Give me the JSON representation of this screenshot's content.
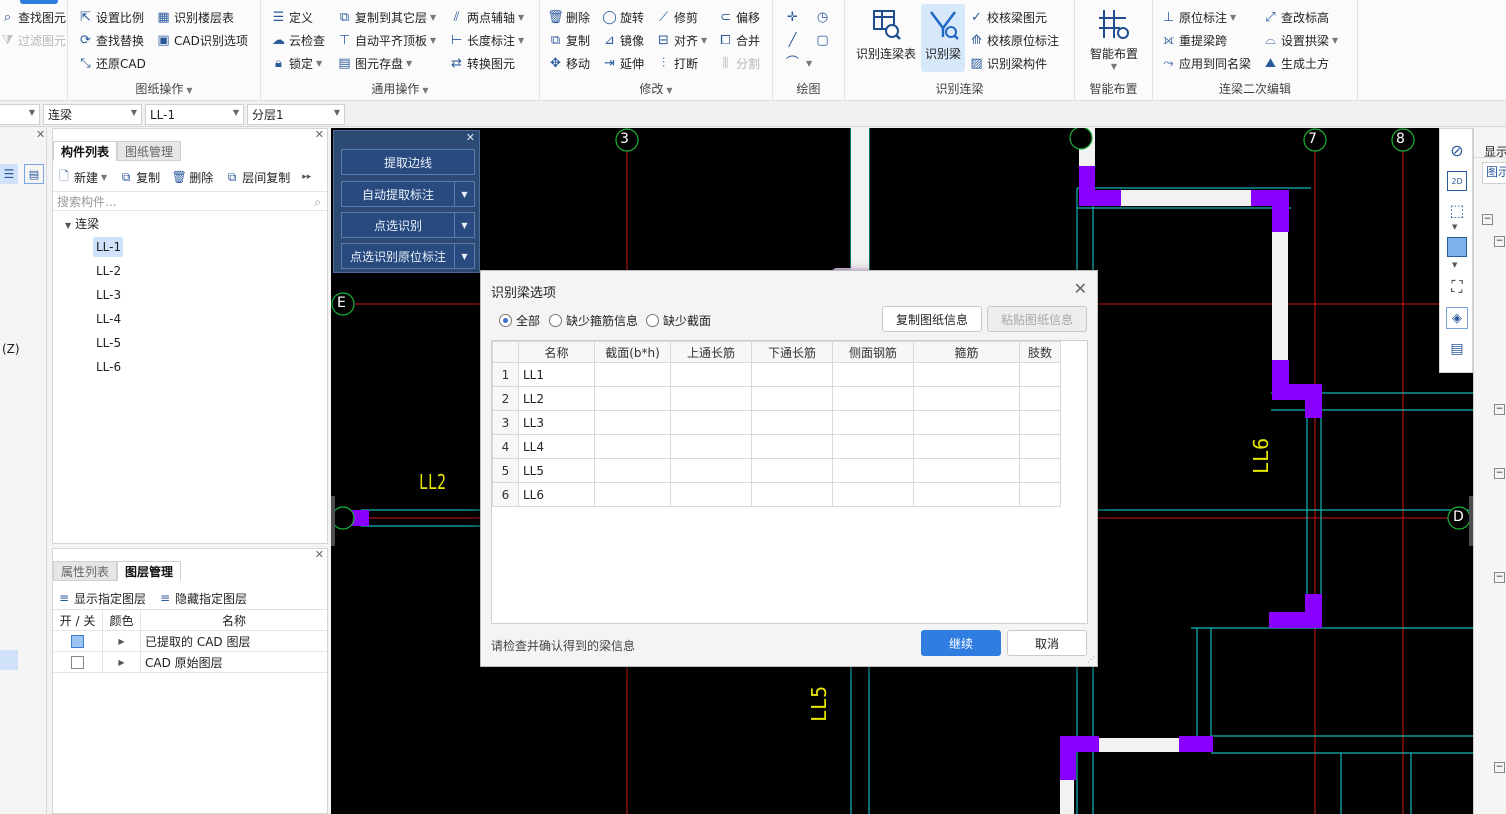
{
  "ribbon": {
    "grp_cad_tools": {
      "find_element": "查找图元",
      "filter_element": "过滤图元"
    },
    "grp_drawing_ops": {
      "title": "图纸操作",
      "set_scale": "设置比例",
      "find_replace": "查找替换",
      "restore_cad": "还原CAD",
      "identify_floor_table": "识别楼层表",
      "cad_identify_options": "CAD识别选项"
    },
    "grp_general_ops": {
      "title": "通用操作",
      "define": "定义",
      "cloud_check": "云检查",
      "lock": "锁定",
      "copy_to_other_floor": "复制到其它层",
      "auto_align_slab": "自动平齐顶板",
      "element_save": "图元存盘",
      "two_point_axis": "两点辅轴",
      "length_dim": "长度标注",
      "convert_element": "转换图元"
    },
    "grp_modify": {
      "title": "修改",
      "delete": "删除",
      "copy": "复制",
      "move": "移动",
      "rotate": "旋转",
      "mirror": "镜像",
      "extend": "延伸",
      "trim": "修剪",
      "align": "对齐",
      "break": "打断",
      "offset": "偏移",
      "merge": "合并",
      "split": "分割"
    },
    "grp_draw": {
      "title": "绘图"
    },
    "grp_identify_beam": {
      "title": "识别连梁",
      "identify_beam_table": "识别连梁表",
      "identify_beam": "识别梁",
      "check_beam_element": "校核梁图元",
      "check_origin_dim": "校核原位标注",
      "identify_beam_component": "识别梁构件"
    },
    "grp_smart": {
      "title": "智能布置",
      "smart_layout": "智能布置"
    },
    "grp_secondary": {
      "title": "连梁二次编辑",
      "origin_dim": "原位标注",
      "re_extract_span": "重提梁跨",
      "apply_same_beam": "应用到同名梁",
      "modify_height": "查改标高",
      "set_arch_beam": "设置拱梁",
      "generate_earthwork": "生成土方"
    }
  },
  "combos": {
    "type": "连梁",
    "component": "LL-1",
    "floor": "分层1"
  },
  "component_panel": {
    "tab_list": "构件列表",
    "tab_drawing": "图纸管理",
    "new": "新建",
    "copy": "复制",
    "delete": "删除",
    "floor_copy": "层间复制",
    "search_placeholder": "搜索构件...",
    "root": "连梁",
    "items": [
      "LL-1",
      "LL-2",
      "LL-3",
      "LL-4",
      "LL-5",
      "LL-6"
    ]
  },
  "left_strip": {
    "z_label": "(Z)"
  },
  "layer_panel": {
    "tab_props": "属性列表",
    "tab_layers": "图层管理",
    "show_layer": "显示指定图层",
    "hide_layer": "隐藏指定图层",
    "col_onoff": "开 / 关",
    "col_color": "颜色",
    "col_name": "名称",
    "rows": [
      {
        "name": "已提取的 CAD 图层",
        "checked": true
      },
      {
        "name": "CAD 原始图层",
        "checked": false
      }
    ]
  },
  "float_panel": {
    "extract_edge": "提取边线",
    "auto_extract_dim": "自动提取标注",
    "click_identify": "点选识别",
    "click_identify_origin": "点选识别原位标注"
  },
  "cad": {
    "axis_labels": [
      "3",
      "7",
      "8",
      "E",
      "D"
    ],
    "beam_labels": [
      "LL2",
      "LL6",
      "LL5"
    ],
    "colors": {
      "background": "#000000",
      "axis_line": "#d01818",
      "axis_circle": "#1bb13a",
      "beam_line": "#13b5b5",
      "column": "#8a00ff",
      "wall": "#f2f2f2",
      "beam_text": "#e6e600"
    }
  },
  "right_pane": {
    "label_1": "显示",
    "label_2": "图示"
  },
  "dialog": {
    "title": "识别梁选项",
    "radio_all": "全部",
    "radio_missing_stirrup": "缺少箍筋信息",
    "radio_missing_section": "缺少截面",
    "copy_info": "复制图纸信息",
    "paste_info": "粘贴图纸信息",
    "columns": [
      "名称",
      "截面(b*h)",
      "上通长筋",
      "下通长筋",
      "侧面钢筋",
      "箍筋",
      "肢数"
    ],
    "rows": [
      {
        "idx": "1",
        "name": "LL1"
      },
      {
        "idx": "2",
        "name": "LL2"
      },
      {
        "idx": "3",
        "name": "LL3"
      },
      {
        "idx": "4",
        "name": "LL4"
      },
      {
        "idx": "5",
        "name": "LL5"
      },
      {
        "idx": "6",
        "name": "LL6"
      }
    ],
    "hint": "请检查并确认得到的梁信息",
    "continue": "继续",
    "cancel": "取消",
    "accent": "#2f7de1"
  }
}
